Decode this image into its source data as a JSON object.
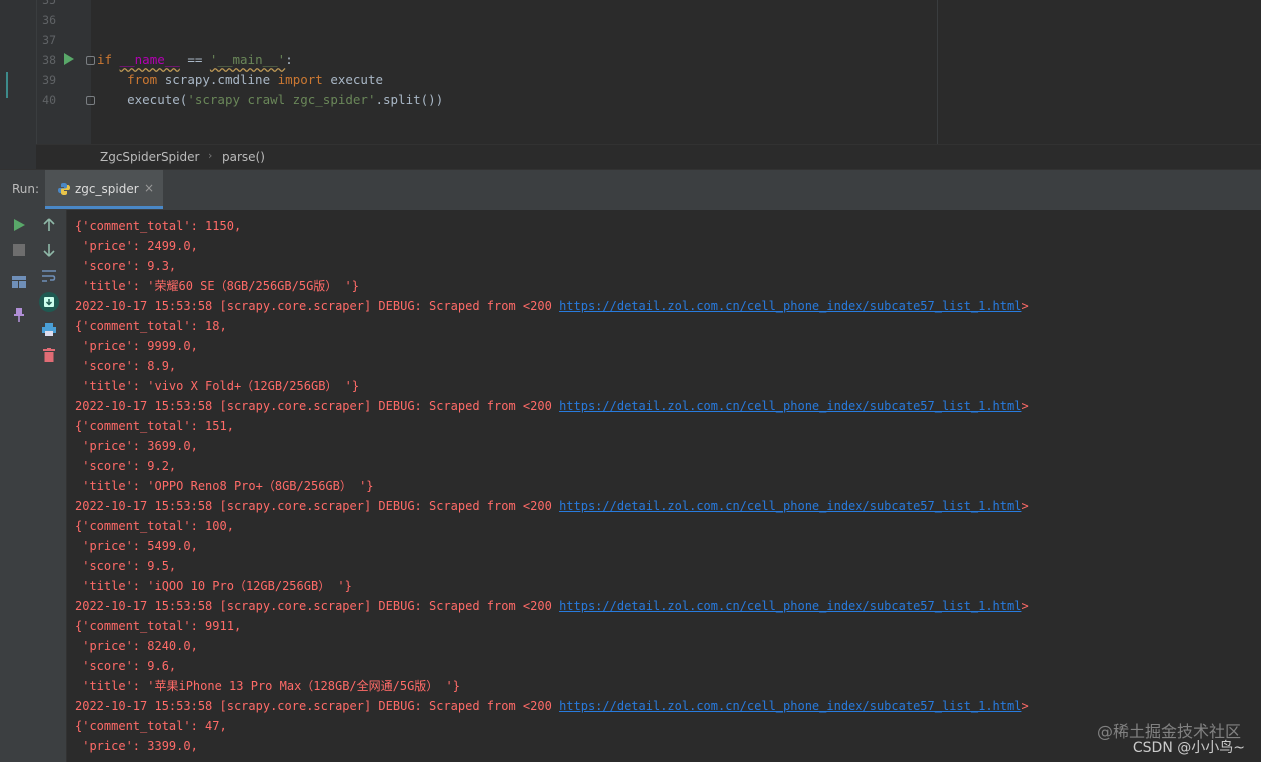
{
  "editor": {
    "line_numbers": [
      "35",
      "36",
      "37",
      "38",
      "39",
      "40"
    ],
    "code": {
      "l38": {
        "kw_if": "if",
        "name": "__name__",
        "op": " == ",
        "main": "'__main__'",
        "colon": ":"
      },
      "l39": {
        "kw_from": "from",
        "module": " scrapy.cmdline ",
        "kw_import": "import",
        "name": " execute"
      },
      "l40": {
        "fn": "execute(",
        "str": "'scrapy crawl zgc_spider'",
        "rest": ".split())"
      }
    }
  },
  "breadcrumb": {
    "items": [
      "ZgcSpiderSpider",
      "parse()"
    ],
    "separator": "›"
  },
  "run_panel": {
    "label": "Run:",
    "tab": {
      "label": "zgc_spider",
      "close": "×"
    }
  },
  "console": {
    "lines": [
      {
        "text": "{'comment_total': 1150,"
      },
      {
        "text": " 'price': 2499.0,"
      },
      {
        "text": " 'score': 9.3,"
      },
      {
        "text": " 'title': '荣耀60 SE（8GB/256GB/5G版） '}"
      },
      {
        "text": "2022-10-17 15:53:58 [scrapy.core.scraper] DEBUG: Scraped from <200 ",
        "link": "https://detail.zol.com.cn/cell_phone_index/subcate57_list_1.html",
        "tail": ">"
      },
      {
        "text": "{'comment_total': 18,"
      },
      {
        "text": " 'price': 9999.0,"
      },
      {
        "text": " 'score': 8.9,"
      },
      {
        "text": " 'title': 'vivo X Fold+（12GB/256GB） '}"
      },
      {
        "text": "2022-10-17 15:53:58 [scrapy.core.scraper] DEBUG: Scraped from <200 ",
        "link": "https://detail.zol.com.cn/cell_phone_index/subcate57_list_1.html",
        "tail": ">"
      },
      {
        "text": "{'comment_total': 151,"
      },
      {
        "text": " 'price': 3699.0,"
      },
      {
        "text": " 'score': 9.2,"
      },
      {
        "text": " 'title': 'OPPO Reno8 Pro+（8GB/256GB） '}"
      },
      {
        "text": "2022-10-17 15:53:58 [scrapy.core.scraper] DEBUG: Scraped from <200 ",
        "link": "https://detail.zol.com.cn/cell_phone_index/subcate57_list_1.html",
        "tail": ">"
      },
      {
        "text": "{'comment_total': 100,"
      },
      {
        "text": " 'price': 5499.0,"
      },
      {
        "text": " 'score': 9.5,"
      },
      {
        "text": " 'title': 'iQOO 10 Pro（12GB/256GB） '}"
      },
      {
        "text": "2022-10-17 15:53:58 [scrapy.core.scraper] DEBUG: Scraped from <200 ",
        "link": "https://detail.zol.com.cn/cell_phone_index/subcate57_list_1.html",
        "tail": ">"
      },
      {
        "text": "{'comment_total': 9911,"
      },
      {
        "text": " 'price': 8240.0,"
      },
      {
        "text": " 'score': 9.6,"
      },
      {
        "text": " 'title': '苹果iPhone 13 Pro Max（128GB/全网通/5G版） '}"
      },
      {
        "text": "2022-10-17 15:53:58 [scrapy.core.scraper] DEBUG: Scraped from <200 ",
        "link": "https://detail.zol.com.cn/cell_phone_index/subcate57_list_1.html",
        "tail": ">"
      },
      {
        "text": "{'comment_total': 47,"
      },
      {
        "text": " 'price': 3399.0,"
      }
    ]
  },
  "watermark": {
    "line1": "@稀土掘金技术社区",
    "line2": "CSDN @小小鸟~"
  },
  "colors": {
    "console_text": "#ff6b68",
    "link": "#287bde",
    "accent": "#4a88c7",
    "run_green": "#59a869",
    "delete_red": "#e06c75"
  }
}
